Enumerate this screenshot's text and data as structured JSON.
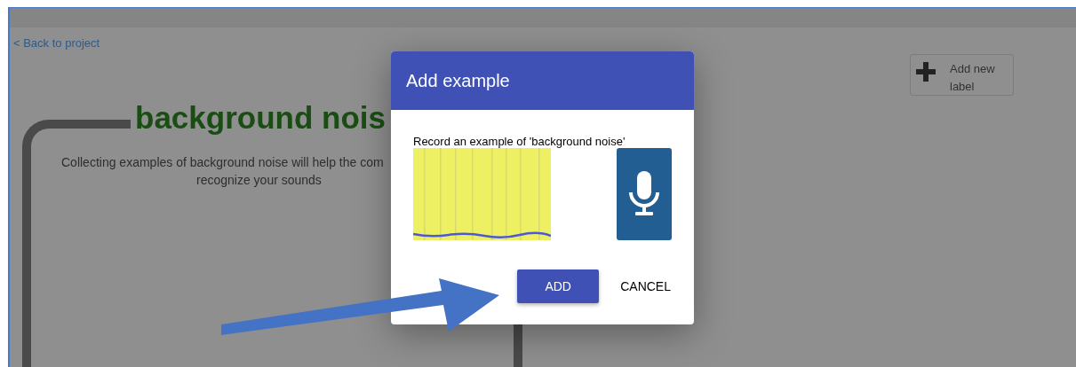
{
  "back_link": "< Back to project",
  "label_title": "background nois",
  "description_lines": [
    "Collecting examples of background noise will help the com",
    "recognize your sounds"
  ],
  "add_label_button": {
    "lines": [
      "Add new",
      "label"
    ]
  },
  "dialog": {
    "title": "Add example",
    "prompt": "Record an example of 'background noise'",
    "buttons": [
      {
        "label": "ADD",
        "kind": "primary"
      },
      {
        "label": "CANCEL",
        "kind": "text"
      }
    ]
  }
}
